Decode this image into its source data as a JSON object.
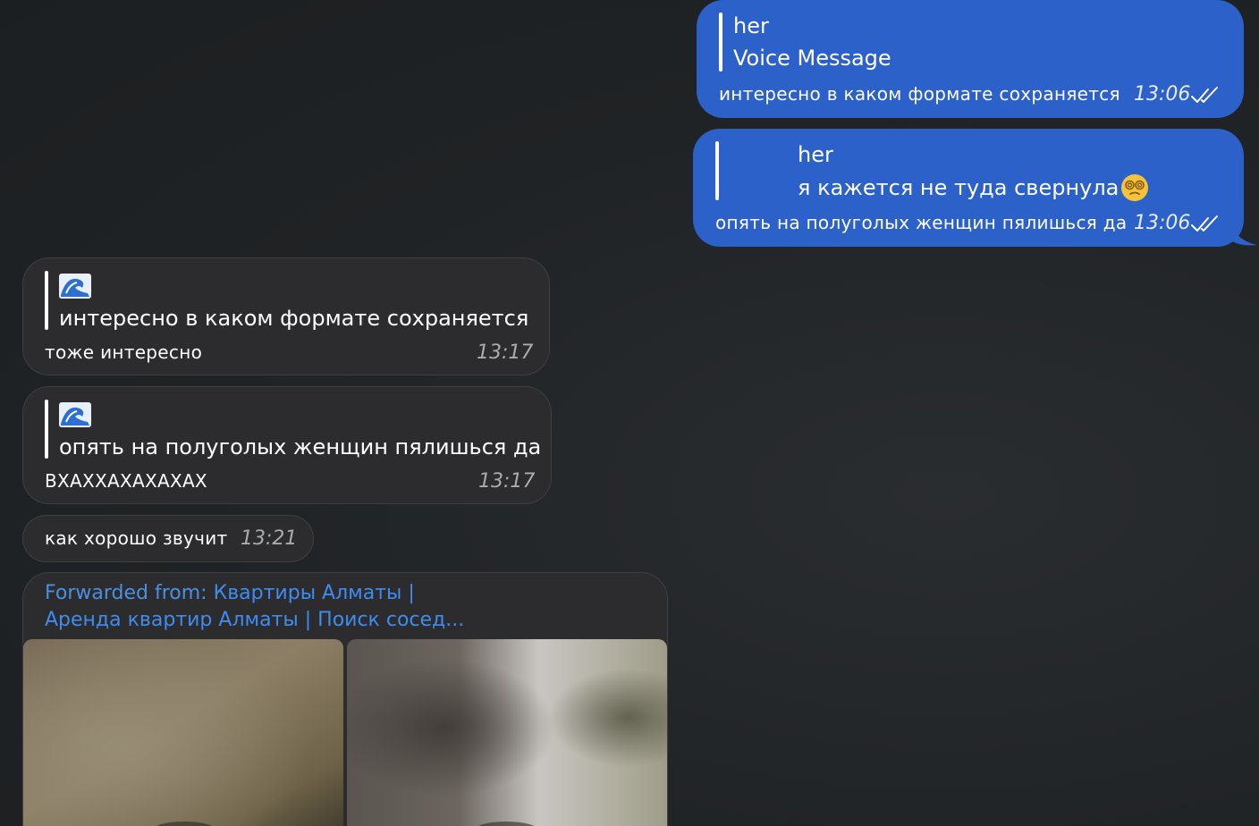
{
  "messages": {
    "out1": {
      "reply_name": "her",
      "reply_text": "Voice Message",
      "text": "интересно в каком формате сохраняется",
      "time": "13:06"
    },
    "out2": {
      "reply_name": "her",
      "reply_text": "я кажется не туда свернула",
      "reply_emoji": "dizzy-face-emoji",
      "text": "опять на полуголых женщин пялишься да",
      "time": "13:06"
    },
    "in1": {
      "reply_icon": "wave-emoji",
      "reply_text": "интересно в каком формате сохраняется",
      "text": "тоже интересно",
      "time": "13:17"
    },
    "in2": {
      "reply_icon": "wave-emoji",
      "reply_text": "опять на полуголых женщин пялишься да",
      "text": "ВХАХХАХАХАХАХ",
      "time": "13:17"
    },
    "in3": {
      "text": "как хорошо звучит",
      "time": "13:21"
    },
    "forward": {
      "label": "Forwarded from: ",
      "source_line1": "Квартиры Алматы |",
      "source_line2": "Аренда квартир Алматы | Поиск сосед..."
    }
  },
  "colors": {
    "outgoing_bubble": "#2b61c8",
    "incoming_bubble": "#2c2c2e",
    "link_blue": "#3e8cf0",
    "background": "#1f2224"
  }
}
